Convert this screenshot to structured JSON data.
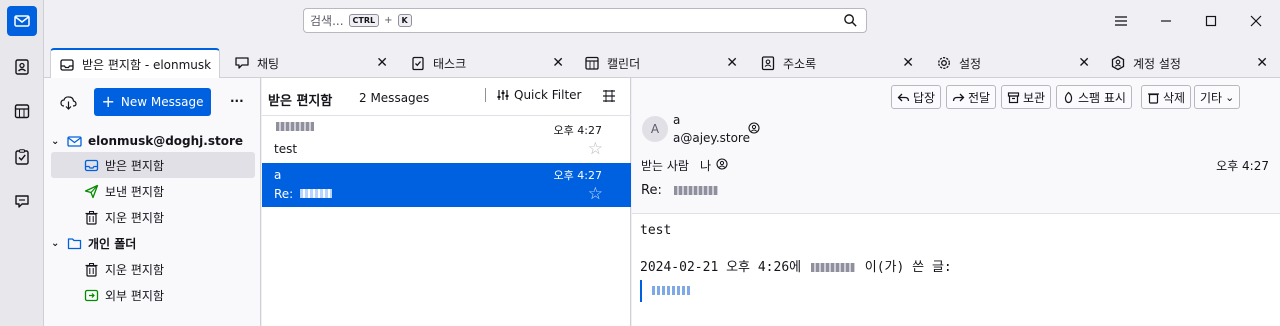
{
  "search": {
    "placeholder": "검색...",
    "kbd_ctrl": "CTRL",
    "kbd_plus": "+",
    "kbd_k": "K"
  },
  "tabs": [
    {
      "label": "받은 편지함 - elonmusk"
    },
    {
      "label": "채팅"
    },
    {
      "label": "태스크"
    },
    {
      "label": "캘린더"
    },
    {
      "label": "주소록"
    },
    {
      "label": "설정"
    },
    {
      "label": "계정 설정"
    }
  ],
  "folder_pane": {
    "new_message": "New Message",
    "more": "···",
    "account": "elonmusk@doghj.store",
    "folders": [
      {
        "label": "받은 편지함",
        "icon": "inbox-icon"
      },
      {
        "label": "보낸 편지함",
        "icon": "sent-icon"
      },
      {
        "label": "지운 편지함",
        "icon": "trash-icon"
      }
    ],
    "local_folders": "개인 폴더",
    "local": [
      {
        "label": "지운 편지함",
        "icon": "trash-icon"
      },
      {
        "label": "외부 편지함",
        "icon": "outbox-icon"
      }
    ]
  },
  "thread_pane": {
    "title": "받은 편지함",
    "count": "2 Messages",
    "quick_filter": "Quick Filter",
    "messages": [
      {
        "time": "오후 4:27",
        "subject": "test"
      },
      {
        "sender": "a",
        "time": "오후 4:27",
        "subject_prefix": "Re:"
      }
    ]
  },
  "message_pane": {
    "buttons": {
      "reply": "답장",
      "forward": "전달",
      "archive": "보관",
      "junk": "스팸 표시",
      "delete": "삭제",
      "more": "기타"
    },
    "avatar_letter": "A",
    "from_name": "a",
    "from_email": "a@ajey.store",
    "to_label": "받는 사람",
    "to_value": "나",
    "date": "오후 4:27",
    "subject_prefix": "Re:",
    "body_line1": "test",
    "body_quote_date": "2024-02-21 오후 4:26에",
    "body_quote_suffix": "이(가) 쓴 글:"
  },
  "colors": {
    "accent": "#0061e0",
    "selected_row": "#0061e0"
  }
}
